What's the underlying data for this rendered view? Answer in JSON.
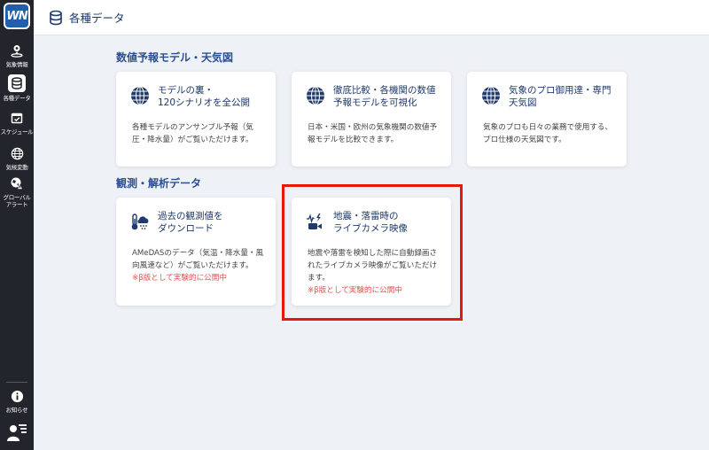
{
  "app": {
    "logo_text": "WN",
    "title": "各種データ"
  },
  "sidebar": {
    "items": [
      {
        "label": "気象情報",
        "icon": "map-pin-icon"
      },
      {
        "label": "各種データ",
        "icon": "database-icon",
        "active": true
      },
      {
        "label": "スケジュール",
        "icon": "calendar-check-icon"
      },
      {
        "label": "気候変動",
        "icon": "globe-icon"
      },
      {
        "label": "グローバルアラート",
        "label_lines": [
          "グローバル",
          "アラート"
        ],
        "icon": "globe-alert-icon"
      }
    ],
    "bottom": [
      {
        "label": "お知らせ",
        "icon": "info-icon"
      },
      {
        "label": "",
        "icon": "user-menu-icon"
      }
    ]
  },
  "sections": [
    {
      "title": "数値予報モデル・天気図",
      "cards": [
        {
          "title_lines": [
            "モデルの裏・",
            "120シナリオを全公開"
          ],
          "desc": "各種モデルのアンサンブル予報（気圧・降水量）がご覧いただけます。",
          "icon": "globe-grid-icon"
        },
        {
          "title_lines": [
            "徹底比較・各機関の数値",
            "予報モデルを可視化"
          ],
          "desc": "日本・米国・欧州の気象機関の数値予報モデルを比較できます。",
          "icon": "globe-grid-icon"
        },
        {
          "title_lines": [
            "気象のプロ御用達・専門",
            "天気図"
          ],
          "desc": "気象のプロも日々の業務で使用する、プロ仕様の天気図です。",
          "icon": "globe-grid-icon"
        }
      ]
    },
    {
      "title": "観測・解析データ",
      "cards": [
        {
          "title_lines": [
            "過去の観測値を",
            "ダウンロード"
          ],
          "desc": "AMeDASのデータ（気温・降水量・風向風速など）がご覧いただけます。",
          "note": "※β版として実験的に公開中",
          "icon": "thermometer-snow-icon"
        },
        {
          "title_lines": [
            "地震・落雷時の",
            "ライブカメラ映像"
          ],
          "desc": "地震や落雷を検知した際に自動録画されたライブカメラ映像がご覧いただけます。",
          "note": "※β版として実験的に公開中",
          "icon": "quake-camera-icon"
        }
      ]
    }
  ],
  "colors": {
    "accent": "#1f3a6b",
    "section_title": "#2a4f92",
    "beta_note": "#e0504f",
    "highlight": "#e8180c",
    "sidebar_bg": "#22262c"
  }
}
